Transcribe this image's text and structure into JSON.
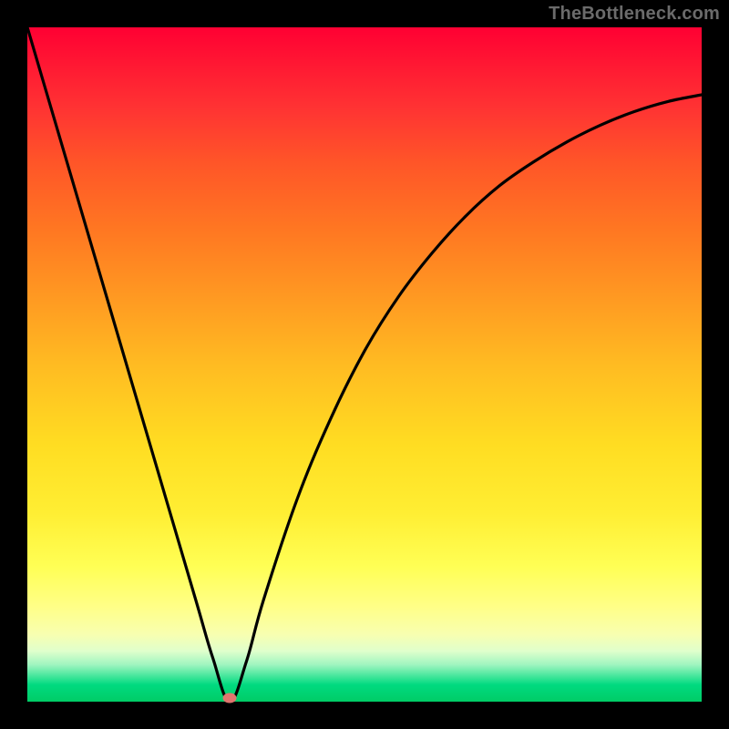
{
  "watermark": "TheBottleneck.com",
  "colors": {
    "curve_stroke": "#000000",
    "marker_fill": "#e0756e",
    "frame": "#000000"
  },
  "chart_data": {
    "type": "line",
    "title": "",
    "xlabel": "",
    "ylabel": "",
    "xlim": [
      0,
      100
    ],
    "ylim": [
      0,
      100
    ],
    "grid": false,
    "legend": false,
    "series": [
      {
        "name": "bottleneck-curve",
        "x": [
          0,
          5,
          10,
          15,
          20,
          25,
          27.5,
          30,
          32.5,
          35,
          40,
          45,
          50,
          55,
          60,
          65,
          70,
          75,
          80,
          85,
          90,
          95,
          100
        ],
        "y": [
          100,
          83,
          66,
          49,
          32,
          15,
          6.5,
          0,
          6,
          15,
          30,
          42,
          52,
          60,
          66.5,
          72,
          76.5,
          80,
          83,
          85.5,
          87.5,
          89,
          90
        ]
      }
    ],
    "marker": {
      "x": 30,
      "y": 0.5
    },
    "background_gradient": {
      "top": "#ff0033",
      "mid": "#ffee33",
      "bottom": "#00cc66"
    }
  }
}
